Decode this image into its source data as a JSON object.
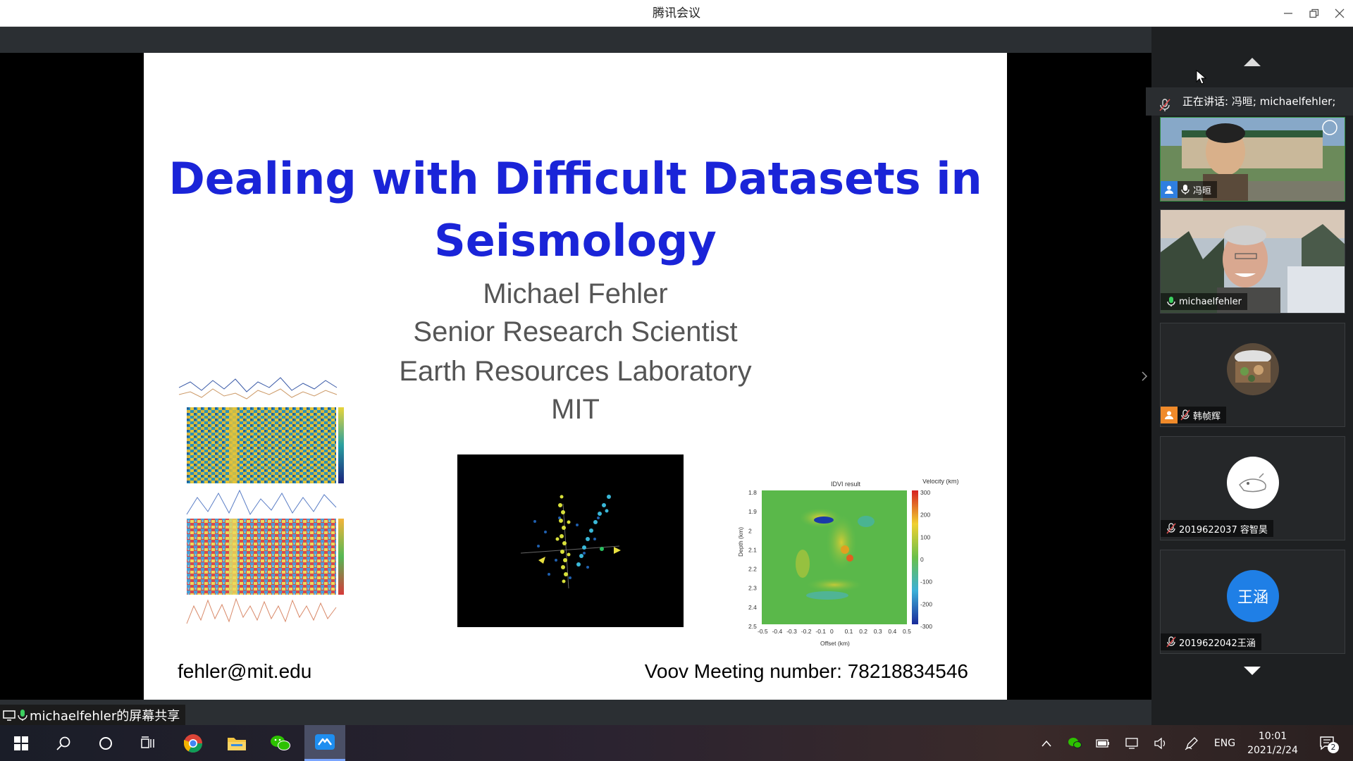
{
  "window": {
    "title": "腾讯会议"
  },
  "slide": {
    "title_line1": "Dealing with Difficult Datasets in",
    "title_line2": "Seismology",
    "author": "Michael Fehler",
    "role": "Senior Research Scientist",
    "lab": "Earth Resources Laboratory",
    "org": "MIT",
    "email": "fehler@mit.edu",
    "meeting": "Voov Meeting number: 78218834546",
    "fig_right": {
      "title": "IDVI result",
      "colorbar_label": "Velocity (km)",
      "ylabel": "Depth (km)",
      "xlabel": "Offset (km)",
      "yticks": [
        "1.8",
        "1.9",
        "2",
        "2.1",
        "2.2",
        "2.3",
        "2.4",
        "2.5"
      ],
      "xticks": [
        "-0.5",
        "-0.4",
        "-0.3",
        "-0.2",
        "-0.1",
        "0",
        "0.1",
        "0.2",
        "0.3",
        "0.4",
        "0.5"
      ],
      "cticks": [
        "300",
        "200",
        "100",
        "0",
        "-100",
        "-200",
        "-300"
      ]
    }
  },
  "sidepanel": {
    "speaking_text": "正在讲话: 冯晅; michaelfehler;",
    "participants": [
      {
        "name": "冯晅",
        "video": true,
        "mic": "on",
        "host_icon": "user-icon"
      },
      {
        "name": "michaelfehler",
        "video": true,
        "mic": "on"
      },
      {
        "name": "韩帧辉",
        "video": false,
        "mic": "muted",
        "host_icon": "user-icon"
      },
      {
        "name": "2019622037 容智昊",
        "video": false,
        "mic": "muted"
      },
      {
        "name": "2019622042王涵",
        "video": false,
        "mic": "muted",
        "avatar_text": "王涵"
      }
    ]
  },
  "share_label": "michaelfehler的屏幕共享",
  "taskbar": {
    "lang": "ENG",
    "time": "10:01",
    "date": "2021/2/24",
    "notification_count": "2"
  }
}
